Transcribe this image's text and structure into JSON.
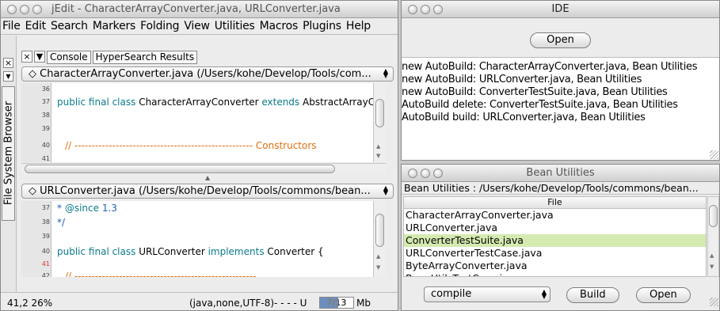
{
  "jedit": {
    "title": "jEdit - CharacterArrayConverter.java, URLConverter.java",
    "menu": [
      "File",
      "Edit",
      "Search",
      "Markers",
      "Folding",
      "View",
      "Utilities",
      "Macros",
      "Plugins",
      "Help"
    ],
    "dock": {
      "close_glyph": "×",
      "menu_glyph": "▼",
      "vertical_tab": "File System Browser"
    },
    "tabs": {
      "close_glyph": "×",
      "menu_glyph": "▼",
      "items": [
        "Console",
        "HyperSearch Results"
      ]
    },
    "top_pane": {
      "buffer": "CharacterArrayConverter.java (/Users/kohe/Develop/Tools/com...",
      "lines": [
        {
          "num": "36",
          "code": ""
        },
        {
          "num": "37",
          "pre": "public final class",
          "mid": " CharacterArrayConverter ",
          "kw2": "extends",
          "post": " AbstractArrayConver"
        },
        {
          "num": "38",
          "code": ""
        },
        {
          "num": "39",
          "code": ""
        },
        {
          "num": "40",
          "comment": "// ---------------------------------------------------- Constructors"
        },
        {
          "num": "41",
          "code": ""
        }
      ]
    },
    "bottom_pane": {
      "buffer": "URLConverter.java (/Users/kohe/Develop/Tools/commons/bean...",
      "lines": [
        {
          "num": "37",
          "star": "* ",
          "tag": "@since",
          "rest": " 1.3"
        },
        {
          "num": "38",
          "star": "*/"
        },
        {
          "num": "39",
          "code": ""
        },
        {
          "num": "40",
          "pre": "public final class",
          "mid": " URLConverter ",
          "kw2": "implements",
          "post": " Converter {"
        },
        {
          "num": "41",
          "code": ""
        },
        {
          "num": "42",
          "comment": "// -----------------------------------------------------"
        }
      ]
    },
    "status": {
      "position": "41,2 26%",
      "mode": "(java,none,UTF-8)- - - - U",
      "memory": "7/13",
      "memory_fraction": 0.54,
      "memory_unit": "Mb"
    }
  },
  "ide": {
    "title": "IDE",
    "open_label": "Open",
    "log": [
      "new AutoBuild: CharacterArrayConverter.java, Bean Utilities",
      "new AutoBuild: URLConverter.java, Bean Utilities",
      "new AutoBuild: ConverterTestSuite.java, Bean Utilities",
      "AutoBuild delete: ConverterTestSuite.java, Bean Utilities",
      "AutoBuild build: URLConverter.java, Bean Utilities"
    ]
  },
  "bean": {
    "title": "Bean Utilities",
    "path": "Bean Utilities : /Users/kohe/Develop/Tools/commons/bean...",
    "column_header": "File",
    "files": [
      "CharacterArrayConverter.java",
      "URLConverter.java",
      "ConverterTestSuite.java",
      "URLConverterTestCase.java",
      "ByteArrayConverter.java",
      "BeanUtilsTestCase.java"
    ],
    "selected_index": 2,
    "target": "compile",
    "build_label": "Build",
    "open_label": "Open"
  }
}
